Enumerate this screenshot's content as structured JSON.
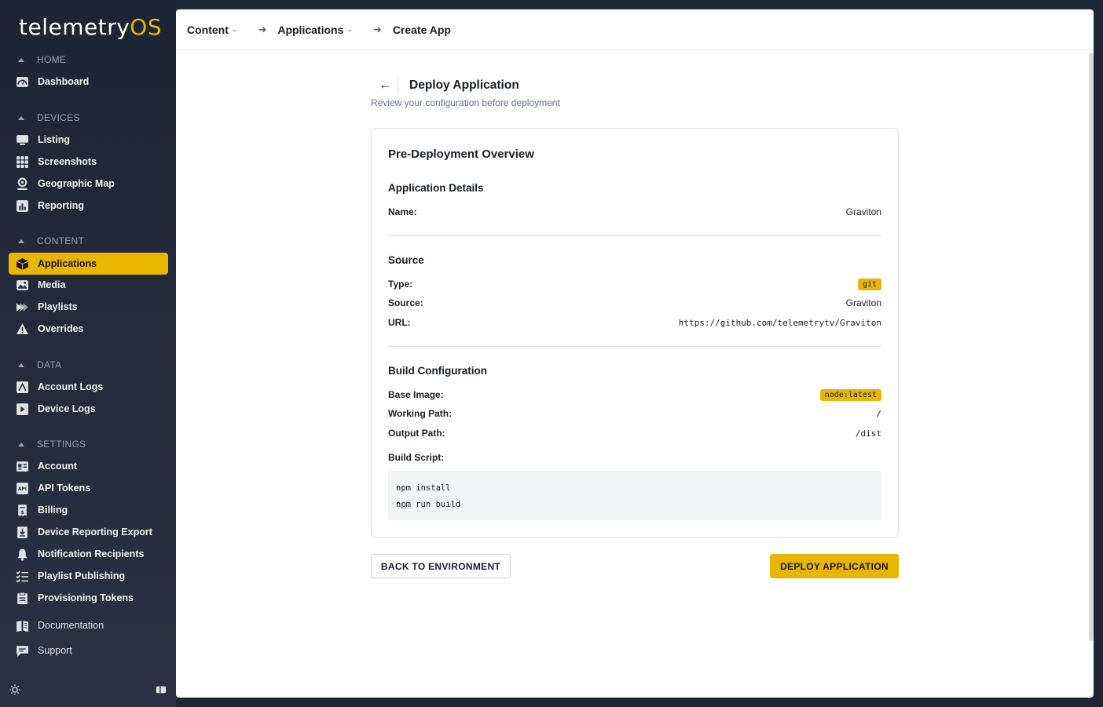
{
  "brand": {
    "name_main": "telemetry",
    "name_accent": "OS",
    "accent_color": "#e8b500"
  },
  "sidebar": {
    "sections": [
      {
        "title": "HOME",
        "items": [
          {
            "label": "Dashboard",
            "icon": "dashboard-icon"
          }
        ]
      },
      {
        "title": "DEVICES",
        "items": [
          {
            "label": "Listing",
            "icon": "monitor-icon"
          },
          {
            "label": "Screenshots",
            "icon": "grid-icon"
          },
          {
            "label": "Geographic Map",
            "icon": "map-pin-icon"
          },
          {
            "label": "Reporting",
            "icon": "bar-chart-icon"
          }
        ]
      },
      {
        "title": "CONTENT",
        "items": [
          {
            "label": "Applications",
            "icon": "cube-icon",
            "active": true
          },
          {
            "label": "Media",
            "icon": "image-icon"
          },
          {
            "label": "Playlists",
            "icon": "playlist-icon"
          },
          {
            "label": "Overrides",
            "icon": "warning-icon"
          }
        ]
      },
      {
        "title": "DATA",
        "items": [
          {
            "label": "Account Logs",
            "icon": "account-log-icon"
          },
          {
            "label": "Device Logs",
            "icon": "device-log-icon"
          }
        ]
      },
      {
        "title": "SETTINGS",
        "items": [
          {
            "label": "Account",
            "icon": "id-card-icon"
          },
          {
            "label": "API Tokens",
            "icon": "api-icon"
          },
          {
            "label": "Billing",
            "icon": "billing-icon"
          },
          {
            "label": "Device Reporting Export",
            "icon": "download-icon"
          },
          {
            "label": "Notification Recipients",
            "icon": "bell-icon"
          },
          {
            "label": "Playlist Publishing",
            "icon": "checklist-icon"
          },
          {
            "label": "Provisioning Tokens",
            "icon": "clipboard-icon"
          }
        ]
      }
    ],
    "footer_items": [
      {
        "label": "Documentation",
        "icon": "book-icon"
      },
      {
        "label": "Support",
        "icon": "chat-icon"
      }
    ]
  },
  "breadcrumb": {
    "items": [
      "Content",
      "Applications",
      "Create App"
    ]
  },
  "page": {
    "title": "Deploy Application",
    "subtitle": "Review your configuration before deployment"
  },
  "card": {
    "title": "Pre-Deployment Overview",
    "app_details": {
      "title": "Application Details",
      "name_label": "Name:",
      "name_value": "Graviton"
    },
    "source": {
      "title": "Source",
      "type_label": "Type:",
      "type_value": "git",
      "source_label": "Source:",
      "source_value": "Graviton",
      "url_label": "URL:",
      "url_value": "https://github.com/telemetrytv/Graviton"
    },
    "build": {
      "title": "Build Configuration",
      "base_image_label": "Base Image:",
      "base_image_value": "node:latest",
      "working_path_label": "Working Path:",
      "working_path_value": "/",
      "output_path_label": "Output Path:",
      "output_path_value": "/dist",
      "build_script_label": "Build Script:",
      "build_script_lines": [
        "npm install",
        "npm run build"
      ]
    }
  },
  "actions": {
    "back_label": "BACK TO ENVIRONMENT",
    "deploy_label": "DEPLOY APPLICATION"
  }
}
